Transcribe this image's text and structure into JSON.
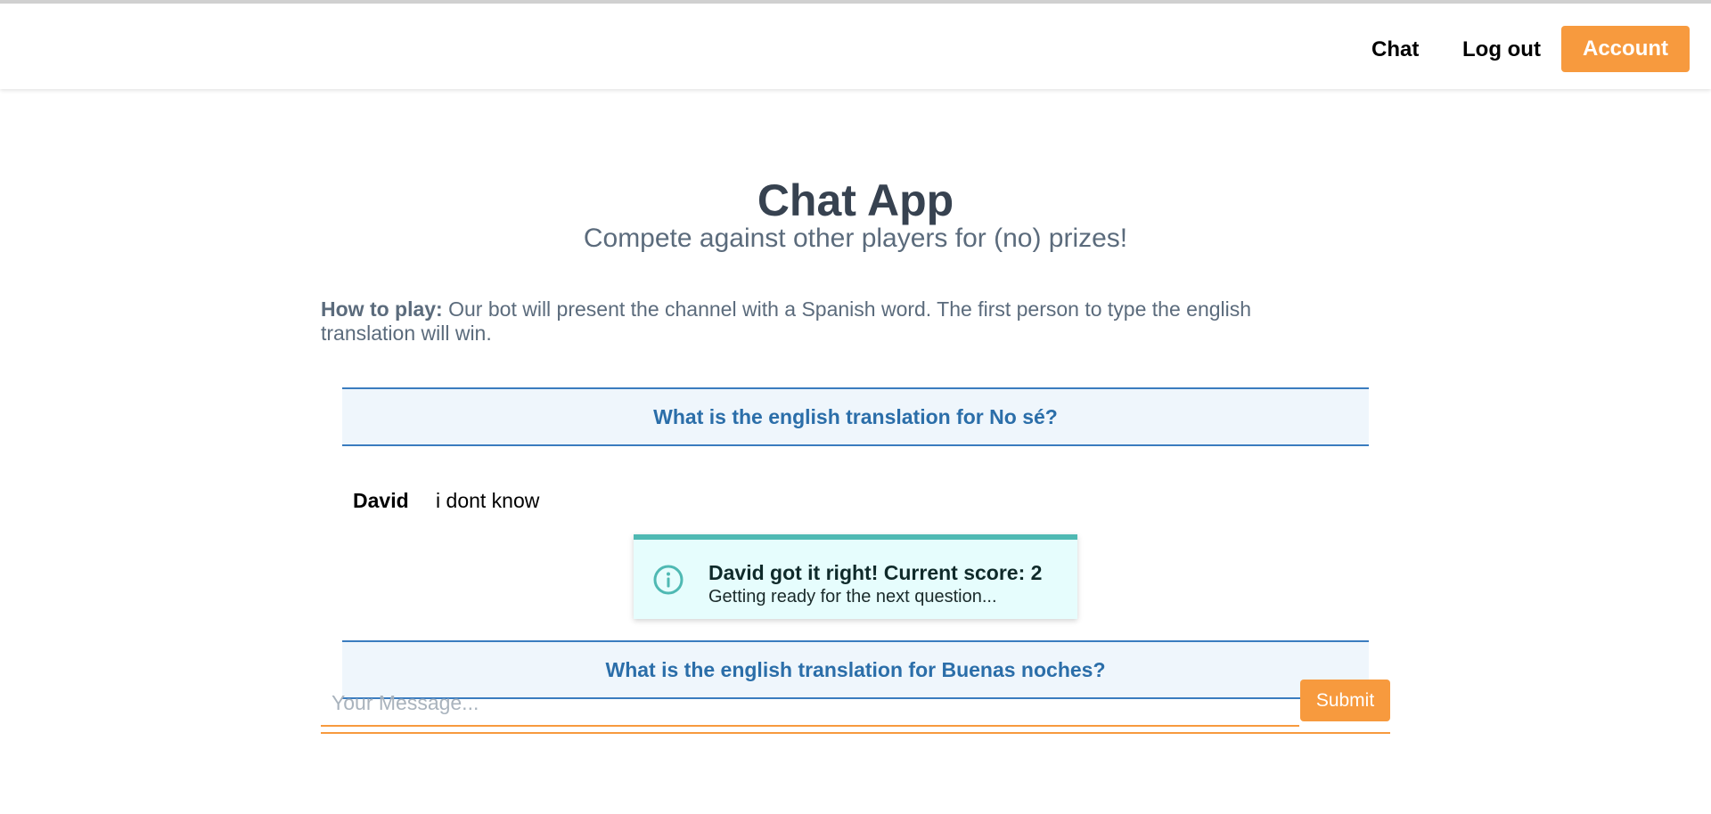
{
  "nav": {
    "chat_label": "Chat",
    "logout_label": "Log out",
    "account_label": "Account"
  },
  "header": {
    "title": "Chat App",
    "subtitle": "Compete against other players for (no) prizes!"
  },
  "instructions": {
    "label": "How to play:",
    "text": "Our bot will present the channel with a Spanish word. The first person to type the english translation will win."
  },
  "chat": {
    "questions": [
      "What is the english translation for No sé?",
      "What is the english translation for Buenas noches?"
    ],
    "messages": [
      {
        "user": "David",
        "text": "i dont know"
      }
    ]
  },
  "toast": {
    "icon": "info-circle-icon",
    "title": "David got it right! Current score: 2",
    "subtitle": "Getting ready for the next question..."
  },
  "composer": {
    "placeholder": "Your Message...",
    "submit_label": "Submit"
  },
  "colors": {
    "accent": "#f79a3e",
    "question_blue": "#2b6ea9",
    "toast_teal": "#4fb9b3"
  }
}
